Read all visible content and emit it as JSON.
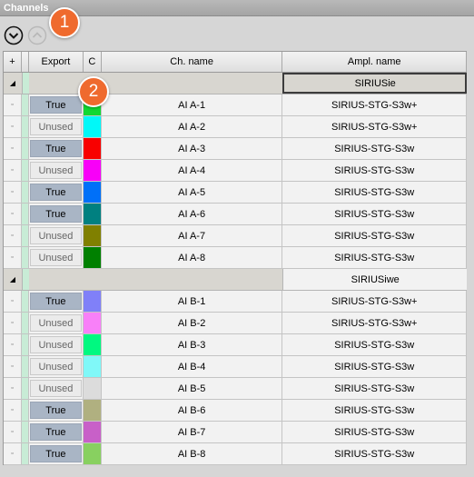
{
  "panel": {
    "title": "Channels"
  },
  "toolbar": {
    "expand_icon": "chevron-down-circle-icon",
    "collapse_icon": "chevron-up-circle-icon"
  },
  "badges": [
    "1",
    "2"
  ],
  "columns": {
    "add": "+",
    "export": "Export",
    "color": "C",
    "ch_name": "Ch. name",
    "ampl_name": "Ampl. name"
  },
  "groups": [
    {
      "name": "SIRIUSie",
      "rows": [
        {
          "export": "True",
          "color": "#10d832",
          "name": "AI A-1",
          "ampl": "SIRIUS-STG-S3w+"
        },
        {
          "export": "Unused",
          "color": "#00f8f8",
          "name": "AI A-2",
          "ampl": "SIRIUS-STG-S3w+"
        },
        {
          "export": "True",
          "color": "#f80000",
          "name": "AI A-3",
          "ampl": "SIRIUS-STG-S3w"
        },
        {
          "export": "Unused",
          "color": "#f800f8",
          "name": "AI A-4",
          "ampl": "SIRIUS-STG-S3w"
        },
        {
          "export": "True",
          "color": "#0070f8",
          "name": "AI A-5",
          "ampl": "SIRIUS-STG-S3w"
        },
        {
          "export": "True",
          "color": "#008080",
          "name": "AI A-6",
          "ampl": "SIRIUS-STG-S3w"
        },
        {
          "export": "Unused",
          "color": "#808000",
          "name": "AI A-7",
          "ampl": "SIRIUS-STG-S3w"
        },
        {
          "export": "Unused",
          "color": "#008000",
          "name": "AI A-8",
          "ampl": "SIRIUS-STG-S3w"
        }
      ]
    },
    {
      "name": "SIRIUSiwe",
      "rows": [
        {
          "export": "True",
          "color": "#8080f8",
          "name": "AI B-1",
          "ampl": "SIRIUS-STG-S3w+"
        },
        {
          "export": "Unused",
          "color": "#f880f8",
          "name": "AI B-2",
          "ampl": "SIRIUS-STG-S3w+"
        },
        {
          "export": "Unused",
          "color": "#00f880",
          "name": "AI B-3",
          "ampl": "SIRIUS-STG-S3w"
        },
        {
          "export": "Unused",
          "color": "#80f8f8",
          "name": "AI B-4",
          "ampl": "SIRIUS-STG-S3w"
        },
        {
          "export": "Unused",
          "color": "#dcdcdc",
          "name": "AI B-5",
          "ampl": "SIRIUS-STG-S3w"
        },
        {
          "export": "True",
          "color": "#b0b080",
          "name": "AI B-6",
          "ampl": "SIRIUS-STG-S3w"
        },
        {
          "export": "True",
          "color": "#c860c8",
          "name": "AI B-7",
          "ampl": "SIRIUS-STG-S3w"
        },
        {
          "export": "True",
          "color": "#88d060",
          "name": "AI B-8",
          "ampl": "SIRIUS-STG-S3w"
        }
      ]
    }
  ]
}
